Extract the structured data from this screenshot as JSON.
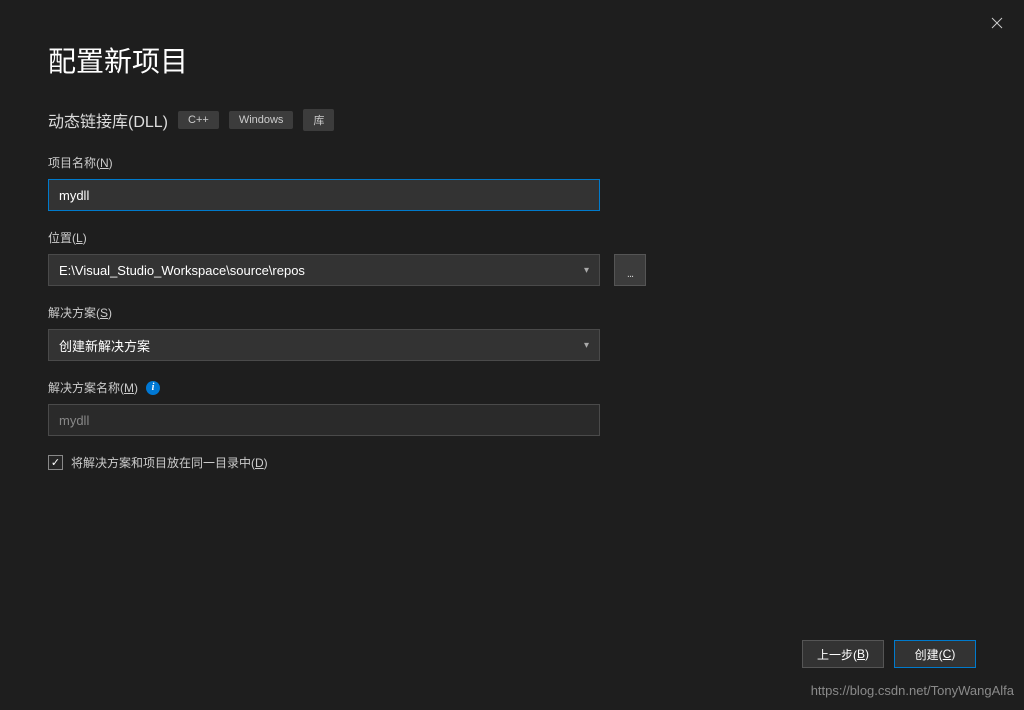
{
  "header": {
    "title": "配置新项目",
    "subtitle": "动态链接库(DLL)",
    "tags": [
      "C++",
      "Windows",
      "库"
    ]
  },
  "fields": {
    "projectName": {
      "label": "项目名称(",
      "mnemonic": "N",
      "labelEnd": ")",
      "value": "mydll"
    },
    "location": {
      "label": "位置(",
      "mnemonic": "L",
      "labelEnd": ")",
      "value": "E:\\Visual_Studio_Workspace\\source\\repos",
      "browseLabel": "..."
    },
    "solution": {
      "label": "解决方案(",
      "mnemonic": "S",
      "labelEnd": ")",
      "value": "创建新解决方案"
    },
    "solutionName": {
      "label": "解决方案名称(",
      "mnemonic": "M",
      "labelEnd": ")",
      "value": "mydll"
    },
    "checkbox": {
      "label": "将解决方案和项目放在同一目录中(",
      "mnemonic": "D",
      "labelEnd": ")",
      "checked": "✓"
    }
  },
  "footer": {
    "backLabel": "上一步(",
    "backMnemonic": "B",
    "backEnd": ")",
    "createLabel": "创建(",
    "createMnemonic": "C",
    "createEnd": ")"
  },
  "watermark": "https://blog.csdn.net/TonyWangAlfa"
}
